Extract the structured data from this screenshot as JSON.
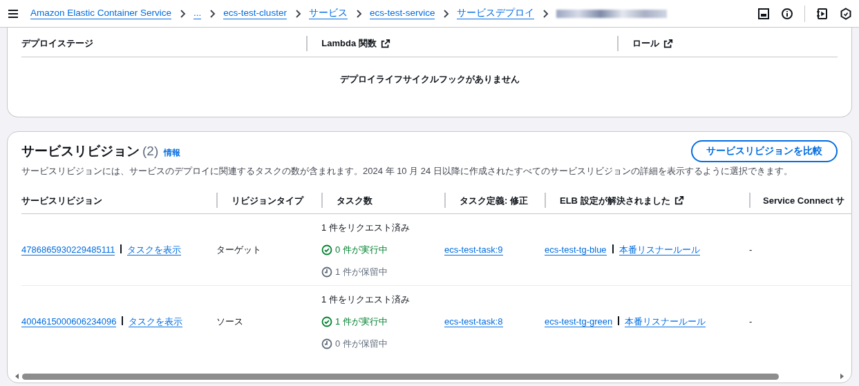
{
  "breadcrumbs": [
    {
      "label": "Amazon Elastic Container Service",
      "kind": "link"
    },
    {
      "label": "...",
      "kind": "link"
    },
    {
      "label": "ecs-test-cluster",
      "kind": "link"
    },
    {
      "label": "サービス",
      "kind": "link"
    },
    {
      "label": "ecs-test-service",
      "kind": "link"
    },
    {
      "label": "サービスデプロイ",
      "kind": "link"
    },
    {
      "kind": "redacted"
    }
  ],
  "hooks_table": {
    "columns": [
      {
        "label": "デプロイステージ",
        "external": false
      },
      {
        "label": "Lambda 関数",
        "external": true
      },
      {
        "label": "ロール",
        "external": true
      }
    ],
    "empty_message": "デプロイライフサイクルフックがありません"
  },
  "revisions": {
    "title": "サービスリビジョン",
    "count": "(2)",
    "info": "情報",
    "compare_button": "サービスリビジョンを比較",
    "description": "サービスリビジョンには、サービスのデプロイに関連するタスクの数が含まれます。2024 年 10 月 24 日以降に作成されたすべてのサービスリビジョンの詳細を表示するように選択できます。",
    "columns": [
      {
        "label": "サービスリビジョン",
        "external": false
      },
      {
        "label": "リビジョンタイプ",
        "external": false
      },
      {
        "label": "タスク数",
        "external": false
      },
      {
        "label": "タスク定義: 修正",
        "external": false
      },
      {
        "label": "ELB 設定が解決されました",
        "external": true
      },
      {
        "label": "Service Connect サ",
        "external": false
      }
    ],
    "rows": [
      {
        "revision": "4786865930229485111",
        "view_tasks": "タスクを表示",
        "type": "ターゲット",
        "tasks": {
          "requested": "1 件をリクエスト済み",
          "running": "0 件が実行中",
          "pending": "1 件が保留中"
        },
        "task_definition": "ecs-test-task:9",
        "target_group": "ecs-test-tg-blue",
        "listener_rule": "本番リスナールール",
        "service_connect": "-"
      },
      {
        "revision": "4004615000606234096",
        "view_tasks": "タスクを表示",
        "type": "ソース",
        "tasks": {
          "requested": "1 件をリクエスト済み",
          "running": "1 件が実行中",
          "pending": "0 件が保留中"
        },
        "task_definition": "ecs-test-task:8",
        "target_group": "ecs-test-tg-green",
        "listener_rule": "本番リスナールール",
        "service_connect": "-"
      }
    ]
  }
}
